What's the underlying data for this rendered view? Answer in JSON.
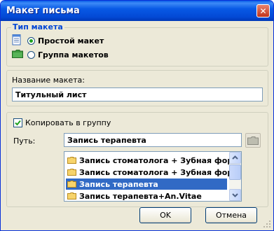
{
  "window": {
    "title": "Макет письма",
    "close_label": "✕"
  },
  "layout_type": {
    "legend": "Тип макета",
    "options": [
      {
        "label": "Простой макет",
        "checked": true
      },
      {
        "label": "Группа макетов",
        "checked": false
      }
    ]
  },
  "name_section": {
    "label": "Название макета:",
    "value": "Титульный лист"
  },
  "copy_section": {
    "checkbox_label": "Копировать в группу",
    "checked": true,
    "path_label": "Путь:",
    "path_value": "Запись терапевта",
    "list_items": [
      {
        "label": "Запись стоматолога + Зубная формула",
        "selected": false
      },
      {
        "label": "Запись стоматолога + Зубная формула",
        "selected": false
      },
      {
        "label": "Запись терапевта",
        "selected": true
      },
      {
        "label": "Запись терапевта+An.Vitae",
        "selected": false
      }
    ]
  },
  "buttons": {
    "ok": "OK",
    "cancel": "Отмена"
  },
  "colors": {
    "title_bar": "#0a5ee7",
    "selection": "#316ac5",
    "legend": "#0046d5"
  }
}
